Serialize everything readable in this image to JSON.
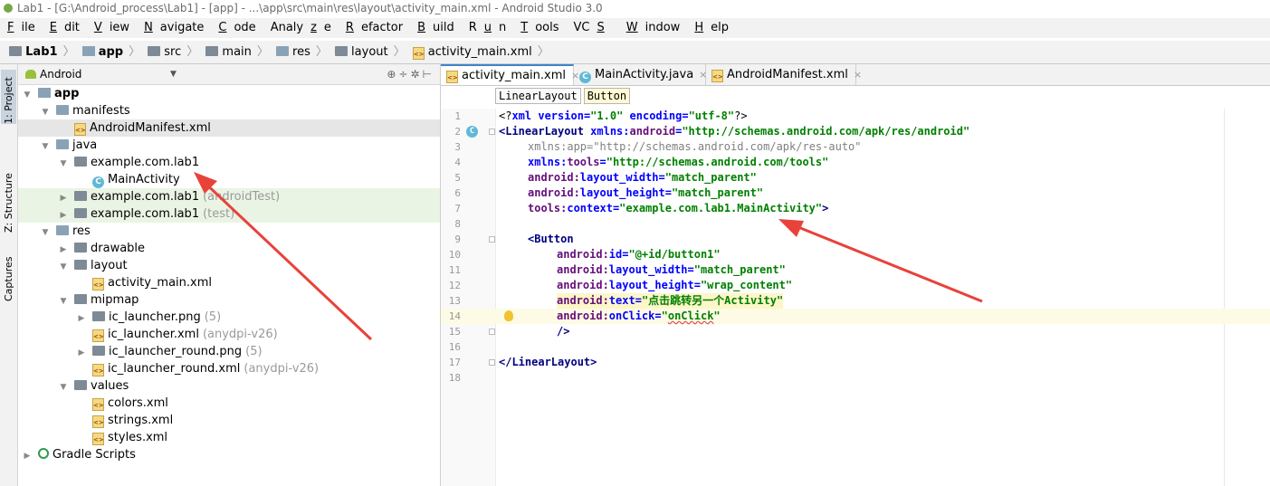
{
  "window": {
    "title": "Lab1 - [G:\\Android_process\\Lab1] - [app] - ...\\app\\src\\main\\res\\layout\\activity_main.xml - Android Studio 3.0"
  },
  "menu": [
    {
      "mn": "F",
      "rest": "ile"
    },
    {
      "mn": "E",
      "rest": "dit"
    },
    {
      "mn": "V",
      "rest": "iew"
    },
    {
      "mn": "N",
      "rest": "avigate"
    },
    {
      "mn": "C",
      "rest": "ode"
    },
    {
      "pre": "Analy",
      "mn": "z",
      "rest": "e"
    },
    {
      "mn": "R",
      "rest": "efactor"
    },
    {
      "mn": "B",
      "rest": "uild"
    },
    {
      "pre": "R",
      "mn": "u",
      "rest": "n"
    },
    {
      "mn": "T",
      "rest": "ools"
    },
    {
      "pre": "VC",
      "mn": "S",
      "rest": ""
    },
    {
      "mn": "W",
      "rest": "indow"
    },
    {
      "mn": "H",
      "rest": "elp"
    }
  ],
  "breadcrumb": [
    "Lab1",
    "app",
    "src",
    "main",
    "res",
    "layout",
    "activity_main.xml"
  ],
  "side_tabs": {
    "project": "1: Project",
    "structure": "Z: Structure",
    "captures": "Captures"
  },
  "project": {
    "view_mode": "Android",
    "tree": [
      {
        "label": "app",
        "extra": ""
      },
      {
        "label": "manifests",
        "extra": ""
      },
      {
        "label": "AndroidManifest.xml",
        "extra": ""
      },
      {
        "label": "java",
        "extra": ""
      },
      {
        "label": "example.com.lab1",
        "extra": ""
      },
      {
        "label": "MainActivity",
        "extra": ""
      },
      {
        "label": "example.com.lab1",
        "extra": "(androidTest)"
      },
      {
        "label": "example.com.lab1",
        "extra": "(test)"
      },
      {
        "label": "res",
        "extra": ""
      },
      {
        "label": "drawable",
        "extra": ""
      },
      {
        "label": "layout",
        "extra": ""
      },
      {
        "label": "activity_main.xml",
        "extra": ""
      },
      {
        "label": "mipmap",
        "extra": ""
      },
      {
        "label": "ic_launcher.png",
        "extra": "(5)"
      },
      {
        "label": "ic_launcher.xml",
        "extra": "(anydpi-v26)"
      },
      {
        "label": "ic_launcher_round.png",
        "extra": "(5)"
      },
      {
        "label": "ic_launcher_round.xml",
        "extra": "(anydpi-v26)"
      },
      {
        "label": "values",
        "extra": ""
      },
      {
        "label": "colors.xml",
        "extra": ""
      },
      {
        "label": "strings.xml",
        "extra": ""
      },
      {
        "label": "styles.xml",
        "extra": ""
      },
      {
        "label": "Gradle Scripts",
        "extra": ""
      }
    ]
  },
  "editor": {
    "tabs": [
      "activity_main.xml",
      "MainActivity.java",
      "AndroidManifest.xml"
    ],
    "tag_crumbs": [
      "LinearLayout",
      "Button"
    ],
    "line_numbers": [
      "1",
      "2",
      "3",
      "4",
      "5",
      "6",
      "7",
      "8",
      "9",
      "10",
      "11",
      "12",
      "13",
      "14",
      "15",
      "16",
      "17",
      "18"
    ],
    "code": {
      "l1": {
        "a": "<?",
        "b": "xml version",
        "c": "=",
        "d": "\"1.0\"",
        "e": " encoding",
        "f": "=",
        "g": "\"utf-8\"",
        "h": "?>"
      },
      "l2": {
        "tag": "<LinearLayout",
        "ns": " xmlns:",
        "attr": "android",
        "eq": "=",
        "val": "\"http://schemas.android.com/apk/res/android\""
      },
      "l3": {
        "ns": "xmlns:",
        "attr": "app",
        "eq": "=",
        "val": "\"http://schemas.android.com/apk/res-auto\""
      },
      "l4": {
        "ns": "xmlns:",
        "attr": "tools",
        "eq": "=",
        "val": "\"http://schemas.android.com/tools\""
      },
      "l5": {
        "ns": "android:",
        "attr": "layout_width",
        "eq": "=",
        "val": "\"match_parent\""
      },
      "l6": {
        "ns": "android:",
        "attr": "layout_height",
        "eq": "=",
        "val": "\"match_parent\""
      },
      "l7": {
        "ns": "tools:",
        "attr": "context",
        "eq": "=",
        "val": "\"example.com.lab1.MainActivity\"",
        "end": ">"
      },
      "l9": {
        "tag": "<Button"
      },
      "l10": {
        "ns": "android:",
        "attr": "id",
        "eq": "=",
        "val": "\"@+id/button1\""
      },
      "l11": {
        "ns": "android:",
        "attr": "layout_width",
        "eq": "=",
        "val": "\"match_parent\""
      },
      "l12": {
        "ns": "android:",
        "attr": "layout_height",
        "eq": "=",
        "val": "\"wrap_content\""
      },
      "l13": {
        "ns": "android:",
        "attr": "text",
        "eq": "=",
        "val": "\"点击跳转另一个Activity\""
      },
      "l14": {
        "ns": "android:",
        "attr": "onClick",
        "eq": "=",
        "q1": "\"",
        "val": "onClick",
        "q2": "\""
      },
      "l15": {
        "end": "/>"
      },
      "l17": {
        "tag": "</LinearLayout",
        "end": ">"
      }
    }
  },
  "colors": {
    "annotation_arrow": "#e8423a",
    "accent_tab": "#4083c9"
  }
}
